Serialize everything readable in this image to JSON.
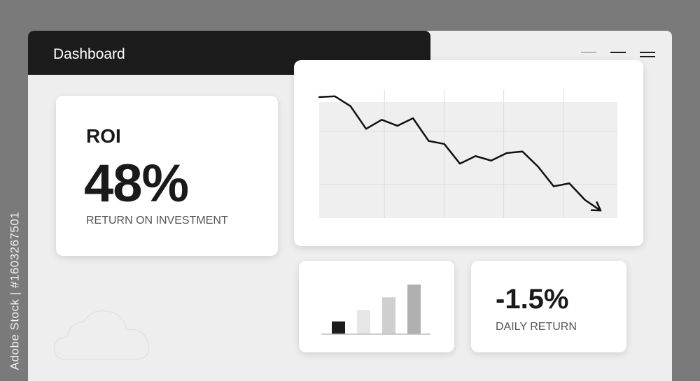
{
  "window": {
    "title": "Dashboard"
  },
  "window_controls": [
    "minimize-icon",
    "maximize-icon",
    "menu-icon"
  ],
  "roi": {
    "label": "ROI",
    "value": "48%",
    "caption": "RETURN ON INVESTMENT"
  },
  "daily": {
    "value": "-1.5%",
    "caption": "DAILY RETURN"
  },
  "stock_id": "Adobe Stock | #1603267501",
  "colors": {
    "titlebar": "#1c1c1c",
    "window": "#eeeeee",
    "card": "#ffffff",
    "text": "#1a1a1a",
    "backdrop": "#7a7a7a"
  },
  "chart_data": [
    {
      "type": "line",
      "x": [
        0,
        1,
        2,
        3,
        4,
        5,
        6,
        7,
        8,
        9,
        10,
        11,
        12,
        13,
        14,
        15,
        16,
        17,
        18
      ],
      "series": [
        {
          "values": [
            100,
            100.5,
            94,
            79,
            85,
            81,
            86,
            71,
            69,
            56,
            61,
            58,
            63,
            64,
            54,
            41,
            43,
            32,
            25
          ]
        }
      ],
      "ylim": [
        20,
        105
      ],
      "grid": true,
      "end_arrow": true
    },
    {
      "type": "bar",
      "categories": [
        "1",
        "2",
        "3",
        "4"
      ],
      "values": [
        18,
        34,
        52,
        70
      ],
      "ylim": [
        0,
        75
      ],
      "bar_colors": [
        "#1c1c1c",
        "#e6e6e6",
        "#cfcfcf",
        "#b0b0b0"
      ]
    }
  ]
}
